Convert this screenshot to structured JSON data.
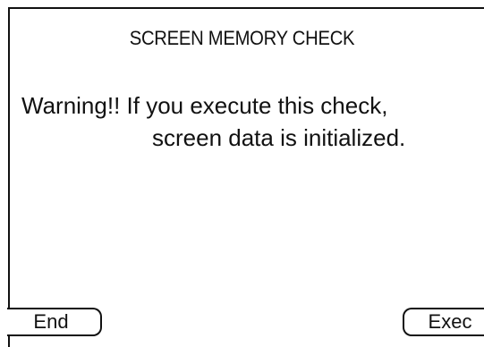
{
  "dialog": {
    "title": "SCREEN MEMORY CHECK",
    "warning_line1": "Warning!! If you execute this check,",
    "warning_line2": "screen data is initialized."
  },
  "buttons": {
    "end_label": "End",
    "exec_label": "Exec"
  }
}
